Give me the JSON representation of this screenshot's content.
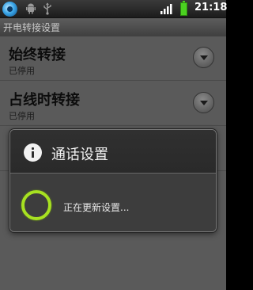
{
  "statusbar": {
    "time": "21:18",
    "icons": [
      "app-icon",
      "android-icon",
      "usb-icon",
      "signal-icon",
      "battery-icon"
    ]
  },
  "titlebar": {
    "title": "开电转接设置"
  },
  "settings": {
    "items": [
      {
        "title": "始终转接",
        "subtitle": "已停用"
      },
      {
        "title": "占线时转接",
        "subtitle": "已停用"
      },
      {
        "title": "",
        "subtitle": ""
      }
    ]
  },
  "dialog": {
    "title": "通话设置",
    "message": "正在更新设置...",
    "icon": "info-icon"
  },
  "colors": {
    "accent_spinner": "#a7e121",
    "battery": "#4bd120"
  }
}
